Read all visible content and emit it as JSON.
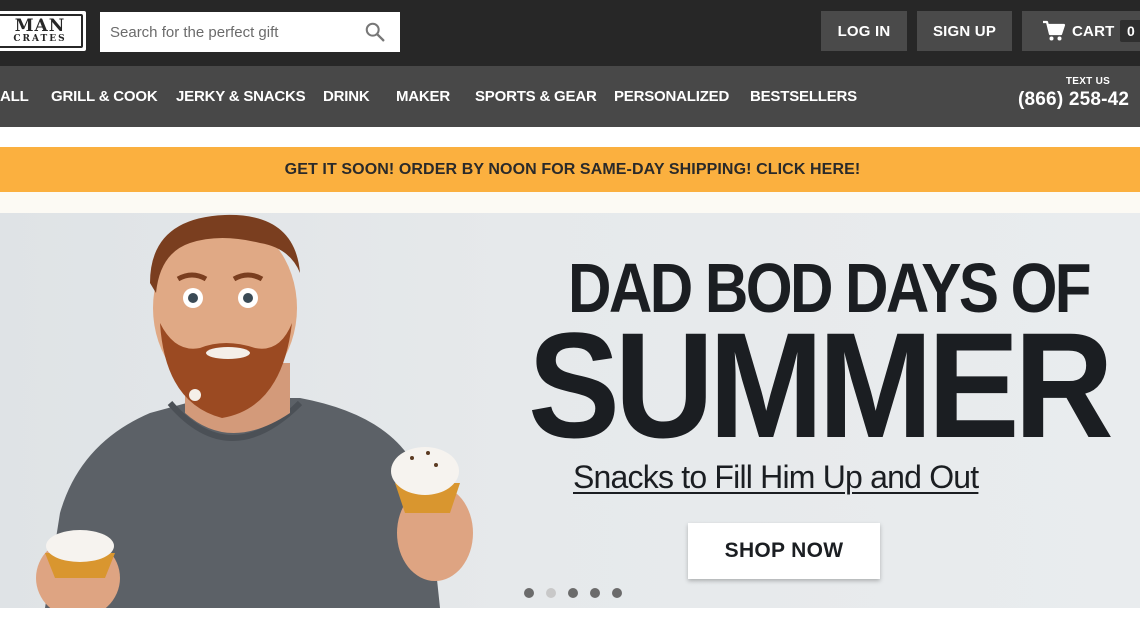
{
  "brand": {
    "logo_line1": "MAN",
    "logo_line2": "CRATES"
  },
  "search": {
    "placeholder": "Search for the perfect gift",
    "icon": "search-icon"
  },
  "header": {
    "login_label": "LOG IN",
    "signup_label": "SIGN UP",
    "cart_label": "CART",
    "cart_count": "0"
  },
  "nav": {
    "items": [
      {
        "label": "ALL"
      },
      {
        "label": "GRILL & COOK"
      },
      {
        "label": "JERKY & SNACKS"
      },
      {
        "label": "DRINK"
      },
      {
        "label": "MAKER"
      },
      {
        "label": "SPORTS & GEAR"
      },
      {
        "label": "PERSONALIZED"
      },
      {
        "label": "BESTSELLERS"
      }
    ],
    "text_us_label": "TEXT US",
    "phone": "(866) 258-42"
  },
  "promo": {
    "text": "GET IT SOON! ORDER BY NOON FOR SAME-DAY SHIPPING! CLICK HERE!"
  },
  "hero": {
    "title_line1": "DAD BOD DAYS OF",
    "title_line2": "SUMMER",
    "subtitle": "Snacks to Fill Him Up and Out",
    "cta_label": "SHOP NOW",
    "slide_count": 5,
    "active_slide": 2
  },
  "colors": {
    "topbar": "#272727",
    "nav": "#484848",
    "promo": "#fbb03f",
    "hero_text": "#1b1e22"
  }
}
